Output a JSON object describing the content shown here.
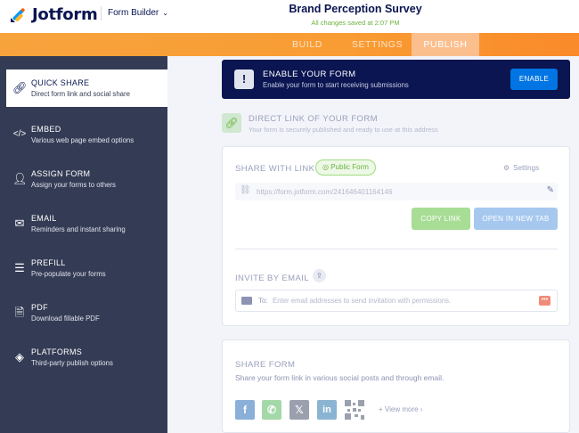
{
  "header": {
    "brand": "Jotform",
    "builder_label": "Form Builder",
    "form_title": "Brand Perception Survey",
    "save_status": "All changes saved at 2:07 PM"
  },
  "tabs": [
    {
      "label": "BUILD",
      "active": false
    },
    {
      "label": "SETTINGS",
      "active": false
    },
    {
      "label": "PUBLISH",
      "active": true
    }
  ],
  "sidebar": {
    "items": [
      {
        "title": "QUICK SHARE",
        "subtitle": "Direct form link and social share",
        "icon": "link-icon",
        "active": true
      },
      {
        "title": "EMBED",
        "subtitle": "Various web page embed options",
        "icon": "code-icon"
      },
      {
        "title": "ASSIGN FORM",
        "subtitle": "Assign your forms to others",
        "icon": "users-icon"
      },
      {
        "title": "EMAIL",
        "subtitle": "Reminders and instant sharing",
        "icon": "envelope-icon"
      },
      {
        "title": "PREFILL",
        "subtitle": "Pre-populate your forms",
        "icon": "prefill-icon"
      },
      {
        "title": "PDF",
        "subtitle": "Download fillable PDF",
        "icon": "pdf-icon"
      },
      {
        "title": "PLATFORMS",
        "subtitle": "Third-party publish options",
        "icon": "layers-icon"
      }
    ]
  },
  "enable_banner": {
    "title": "ENABLE YOUR FORM",
    "subtitle": "Enable your form to start receiving submissions",
    "button": "ENABLE"
  },
  "direct_link": {
    "title": "DIRECT LINK OF YOUR FORM",
    "subtitle": "Your form is securely published and ready to use at this address"
  },
  "share_link": {
    "label": "SHARE WITH LINK",
    "badge": "Public Form",
    "settings": "Settings",
    "url": "https://form.jotform.com/241646401164146",
    "copy_button": "COPY LINK",
    "open_button": "OPEN IN NEW TAB"
  },
  "invite": {
    "label": "INVITE BY EMAIL",
    "to_label": "To:",
    "placeholder": "Enter email addresses to send invitation with permissions."
  },
  "share_form": {
    "label": "SHARE FORM",
    "subtitle": "Share your form link in various social posts and through email.",
    "view_more": "View more",
    "networks": [
      "facebook",
      "whatsapp",
      "x",
      "linkedin",
      "qr-code"
    ]
  },
  "colors": {
    "navy": "#0a1551",
    "orange": "#f99c33",
    "sidebar": "#343c55",
    "enable_blue": "#0075e3",
    "green": "#6bb33c"
  }
}
